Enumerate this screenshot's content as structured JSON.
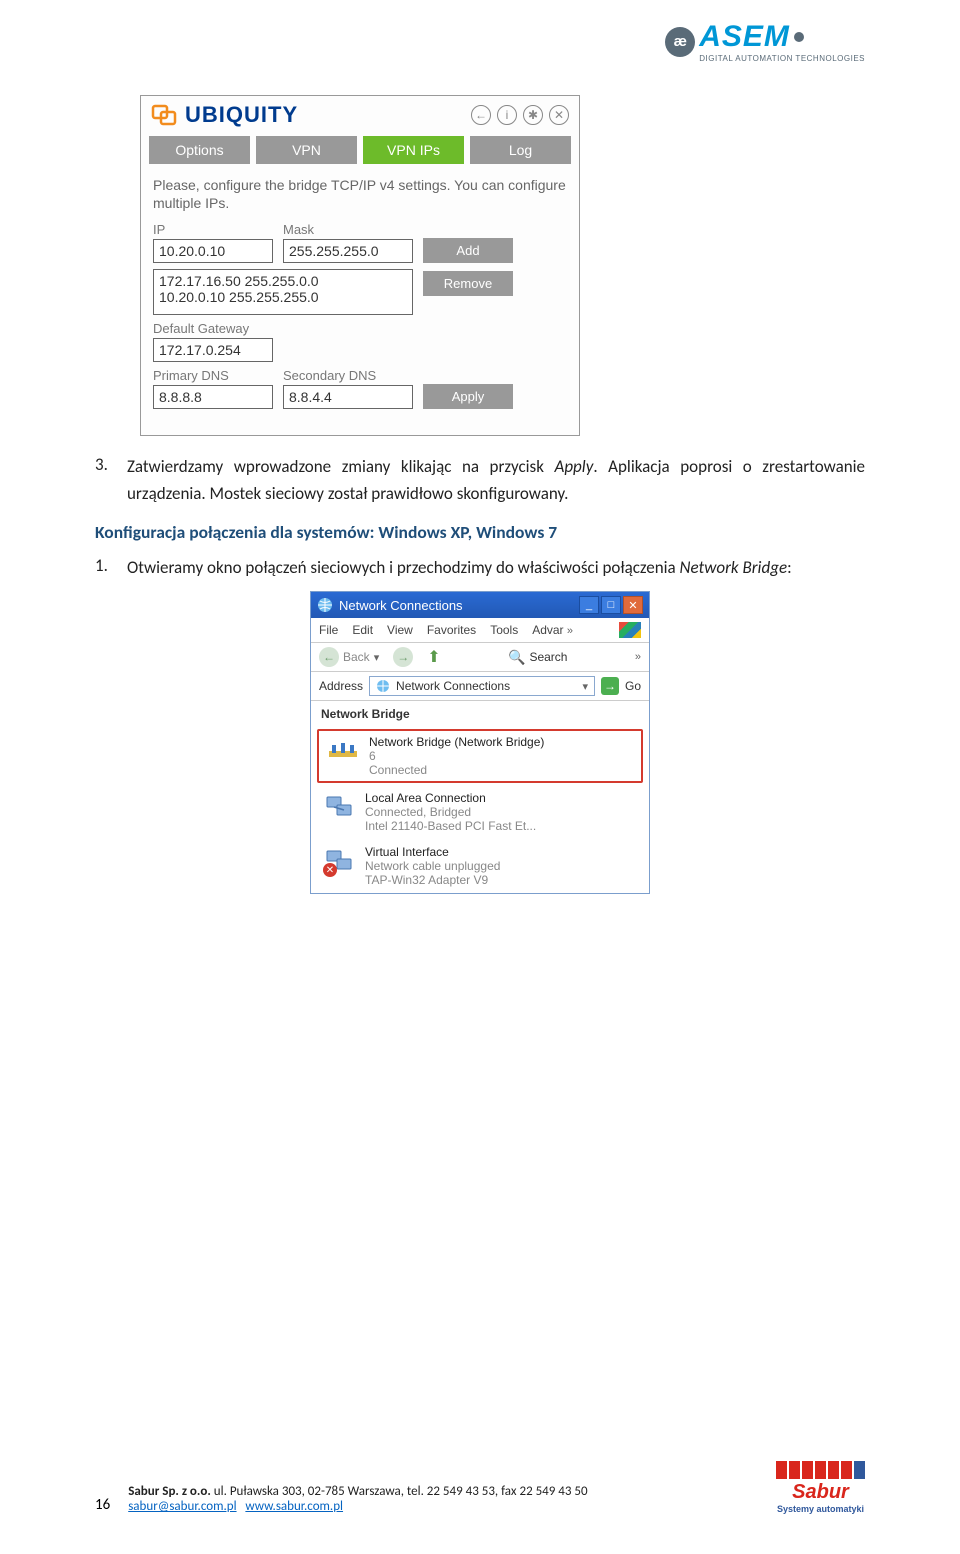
{
  "header": {
    "brand_main": "ASEM",
    "brand_sub": "DIGITAL AUTOMATION TECHNOLOGIES",
    "brand_mark": "æ"
  },
  "ubiquity": {
    "title": "UBIQUITY",
    "icons": {
      "back": "←",
      "info": "i",
      "settings": "✱",
      "close": "✕"
    },
    "tabs": {
      "options": "Options",
      "vpn": "VPN",
      "vpn_ips": "VPN IPs",
      "log": "Log"
    },
    "instruction": "Please, configure the bridge TCP/IP v4 settings. You can configure multiple IPs.",
    "labels": {
      "ip": "IP",
      "mask": "Mask",
      "gateway": "Default Gateway",
      "pdns": "Primary DNS",
      "sdns": "Secondary DNS"
    },
    "values": {
      "ip": "10.20.0.10",
      "mask": "255.255.255.0",
      "gateway": "172.17.0.254",
      "pdns": "8.8.8.8",
      "sdns": "8.8.4.4"
    },
    "list": [
      "172.17.16.50 255.255.0.0",
      "10.20.0.10 255.255.255.0"
    ],
    "buttons": {
      "add": "Add",
      "remove": "Remove",
      "apply": "Apply"
    }
  },
  "document": {
    "item3_num": "3.",
    "item3_text_a": "Zatwierdzamy wprowadzone zmiany klikając na przycisk ",
    "item3_apply": "Apply",
    "item3_text_b": ". Aplikacja poprosi o zrestartowanie urządzenia. Mostek sieciowy został prawidłowo skonfigurowany.",
    "heading": "Konfiguracja połączenia dla systemów: Windows XP, Windows 7",
    "item1_num": "1.",
    "item1_text_a": "Otwieramy okno połączeń sieciowych i przechodzimy do właściwości połączenia ",
    "item1_nb": "Network Bridge",
    "item1_text_b": ":"
  },
  "nc": {
    "title": "Network Connections",
    "menu": {
      "file": "File",
      "edit": "Edit",
      "view": "View",
      "favorites": "Favorites",
      "tools": "Tools",
      "advar": "Advar"
    },
    "back": "Back",
    "search": "Search",
    "address_label": "Address",
    "address_value": "Network Connections",
    "go": "Go",
    "section": "Network Bridge",
    "items": [
      {
        "title": "Network Bridge (Network Bridge)",
        "line2": "6",
        "line3": "Connected"
      },
      {
        "title": "Local Area Connection",
        "line2": "Connected, Bridged",
        "line3": "Intel 21140-Based PCI Fast Et..."
      },
      {
        "title": "Virtual Interface",
        "line2": "Network cable unplugged",
        "line3": "TAP-Win32 Adapter V9"
      }
    ]
  },
  "footer": {
    "page": "16",
    "line1_a": "Sabur Sp. z o.o.",
    "line1_b": " ul. Puławska 303, 02-785 Warszawa, tel. 22 549 43 53, fax 22 549 43 50",
    "email": "sabur@sabur.com.pl",
    "url": "www.sabur.com.pl",
    "logo_main": "Sabur",
    "logo_sub": "Systemy automatyki"
  }
}
